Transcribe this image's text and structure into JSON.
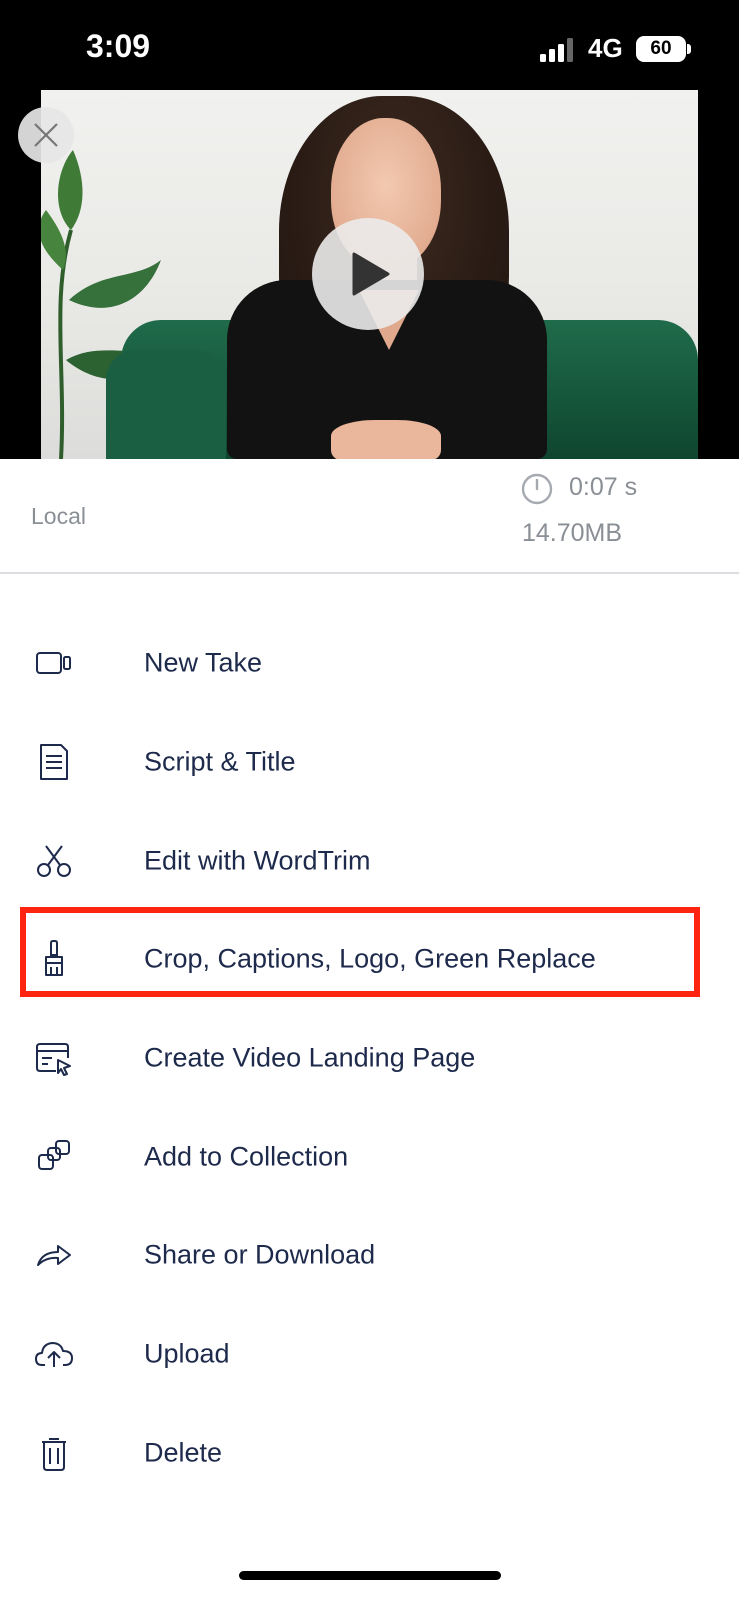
{
  "status_bar": {
    "time": "3:09",
    "network": "4G",
    "battery": "60"
  },
  "video": {
    "close_icon": "close-icon",
    "play_icon": "play-icon"
  },
  "meta": {
    "source": "Local",
    "duration": "0:07 s",
    "file_size": "14.70MB"
  },
  "menu": {
    "items": [
      {
        "label": "New Take",
        "icon": "video-camera-icon"
      },
      {
        "label": "Script & Title",
        "icon": "document-icon"
      },
      {
        "label": "Edit with WordTrim",
        "icon": "scissors-icon"
      },
      {
        "label": "Crop, Captions, Logo, Green Replace",
        "icon": "paintbrush-icon"
      },
      {
        "label": "Create Video Landing Page",
        "icon": "landing-page-icon"
      },
      {
        "label": "Add to Collection",
        "icon": "collection-icon"
      },
      {
        "label": "Share or Download",
        "icon": "share-icon"
      },
      {
        "label": "Upload",
        "icon": "cloud-upload-icon"
      },
      {
        "label": "Delete",
        "icon": "trash-icon"
      }
    ]
  },
  "colors": {
    "menu_text": "#1d2a4b",
    "meta_text": "#8a8f96",
    "highlight": "#ff2410"
  }
}
